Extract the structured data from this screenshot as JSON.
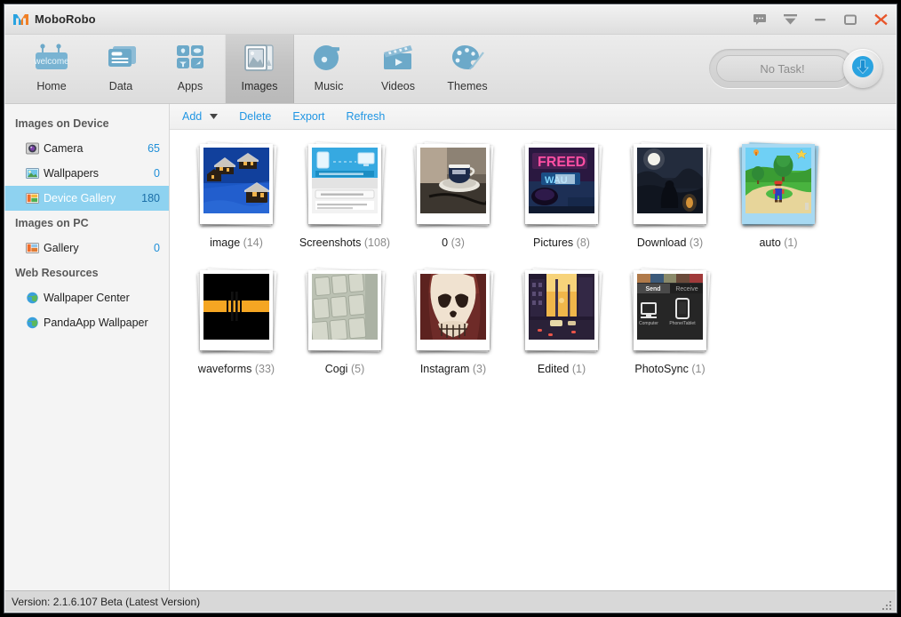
{
  "window": {
    "title": "MoboRobo",
    "logo_icon": "moborobo-m-logo",
    "controls": [
      {
        "name": "feedback-icon",
        "label": "Feedback"
      },
      {
        "name": "minimize-to-tray-icon",
        "label": "Minimize to tray"
      },
      {
        "name": "minimize-icon",
        "label": "Minimize"
      },
      {
        "name": "maximize-icon",
        "label": "Maximize"
      },
      {
        "name": "close-icon",
        "label": "Close"
      }
    ]
  },
  "modules": [
    {
      "label": "Home",
      "icon": "welcome-sign-icon",
      "active": false
    },
    {
      "label": "Data",
      "icon": "cards-icon",
      "active": false
    },
    {
      "label": "Apps",
      "icon": "app-grid-icon",
      "active": false
    },
    {
      "label": "Images",
      "icon": "pictures-icon",
      "active": true
    },
    {
      "label": "Music",
      "icon": "music-note-icon",
      "active": false
    },
    {
      "label": "Videos",
      "icon": "clapperboard-icon",
      "active": false
    },
    {
      "label": "Themes",
      "icon": "palette-icon",
      "active": false
    }
  ],
  "task": {
    "status_label": "No Task!",
    "download_icon": "download-arrow-icon"
  },
  "sidebar": {
    "groups": [
      {
        "title": "Images on Device",
        "items": [
          {
            "label": "Camera",
            "count": "65",
            "icon": "camera-icon",
            "selected": false
          },
          {
            "label": "Wallpapers",
            "count": "0",
            "icon": "wallpaper-icon",
            "selected": false
          },
          {
            "label": "Device Gallery",
            "count": "180",
            "icon": "device-gallery-icon",
            "selected": true
          }
        ]
      },
      {
        "title": "Images on PC",
        "items": [
          {
            "label": "Gallery",
            "count": "0",
            "icon": "pc-gallery-icon",
            "selected": false
          }
        ]
      },
      {
        "title": "Web Resources",
        "items": [
          {
            "label": "Wallpaper Center",
            "count": "",
            "icon": "globe-icon",
            "selected": false
          },
          {
            "label": "PandaApp Wallpaper",
            "count": "",
            "icon": "globe-icon",
            "selected": false
          }
        ]
      }
    ]
  },
  "actionbar": {
    "buttons": [
      {
        "label": "Add",
        "name": "add-button"
      },
      {
        "label": "Delete",
        "name": "delete-button"
      },
      {
        "label": "Export",
        "name": "export-button"
      },
      {
        "label": "Refresh",
        "name": "refresh-button"
      }
    ],
    "dropdown_icon": "chevron-down-icon",
    "link_color": "#2196e3"
  },
  "albums": [
    {
      "name": "image",
      "count": "(14)",
      "thumb": "winter-village",
      "selected": false
    },
    {
      "name": "Screenshots",
      "count": "(108)",
      "thumb": "app-screenshot",
      "selected": false
    },
    {
      "name": "0",
      "count": "(3)",
      "thumb": "coffee-cup",
      "selected": false
    },
    {
      "name": "Pictures",
      "count": "(8)",
      "thumb": "neon-sign",
      "selected": false
    },
    {
      "name": "Download",
      "count": "(3)",
      "thumb": "moonlit-figure",
      "selected": false
    },
    {
      "name": "auto",
      "count": "(1)",
      "thumb": "mario-game",
      "selected": true
    },
    {
      "name": "waveforms",
      "count": "(33)",
      "thumb": "waveform-stripe",
      "selected": false
    },
    {
      "name": "Cogi",
      "count": "(5)",
      "thumb": "keyboard-keys",
      "selected": false
    },
    {
      "name": "Instagram",
      "count": "(3)",
      "thumb": "skull-facepaint",
      "selected": false
    },
    {
      "name": "Edited",
      "count": "(1)",
      "thumb": "sunset-street",
      "selected": false
    },
    {
      "name": "PhotoSync",
      "count": "(1)",
      "thumb": "photosync-app",
      "selected": false
    }
  ],
  "statusbar": {
    "text": "Version: 2.1.6.107 Beta  (Latest Version)",
    "grip_icon": "resize-grip-icon"
  },
  "colors": {
    "accent_blue": "#2196e3",
    "selection_blue": "#8ed2f0",
    "close_orange": "#e8552a",
    "icon_blue": "#6ca9c9"
  }
}
